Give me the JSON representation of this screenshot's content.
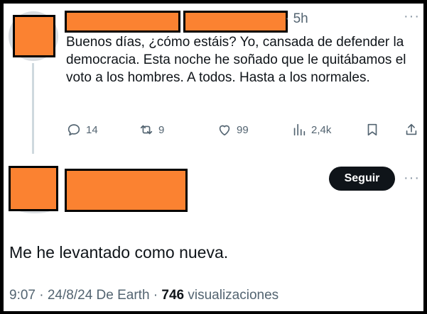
{
  "tweet1": {
    "time": "· 5h",
    "text": "Buenos días, ¿cómo estáis? Yo, cansada de defender la democracia. Esta noche he soñado que le quitábamos el voto a los hombres. A todos. Hasta a los normales.",
    "more": "···",
    "actions": {
      "replies": "14",
      "retweets": "9",
      "likes": "99",
      "views": "2,4k"
    }
  },
  "tweet2": {
    "follow_label": "Seguir",
    "more": "···",
    "text": "Me he levantado como nueva.",
    "meta_prefix": "9:07 · 24/8/24 De Earth · ",
    "views_count": "746",
    "views_label": " visualizaciones"
  },
  "colors": {
    "redaction": "#fb8231",
    "muted": "#536471",
    "thread_line": "#cfd9de"
  },
  "icons": [
    "reply-icon",
    "retweet-icon",
    "like-icon",
    "views-icon",
    "bookmark-icon",
    "share-icon"
  ]
}
